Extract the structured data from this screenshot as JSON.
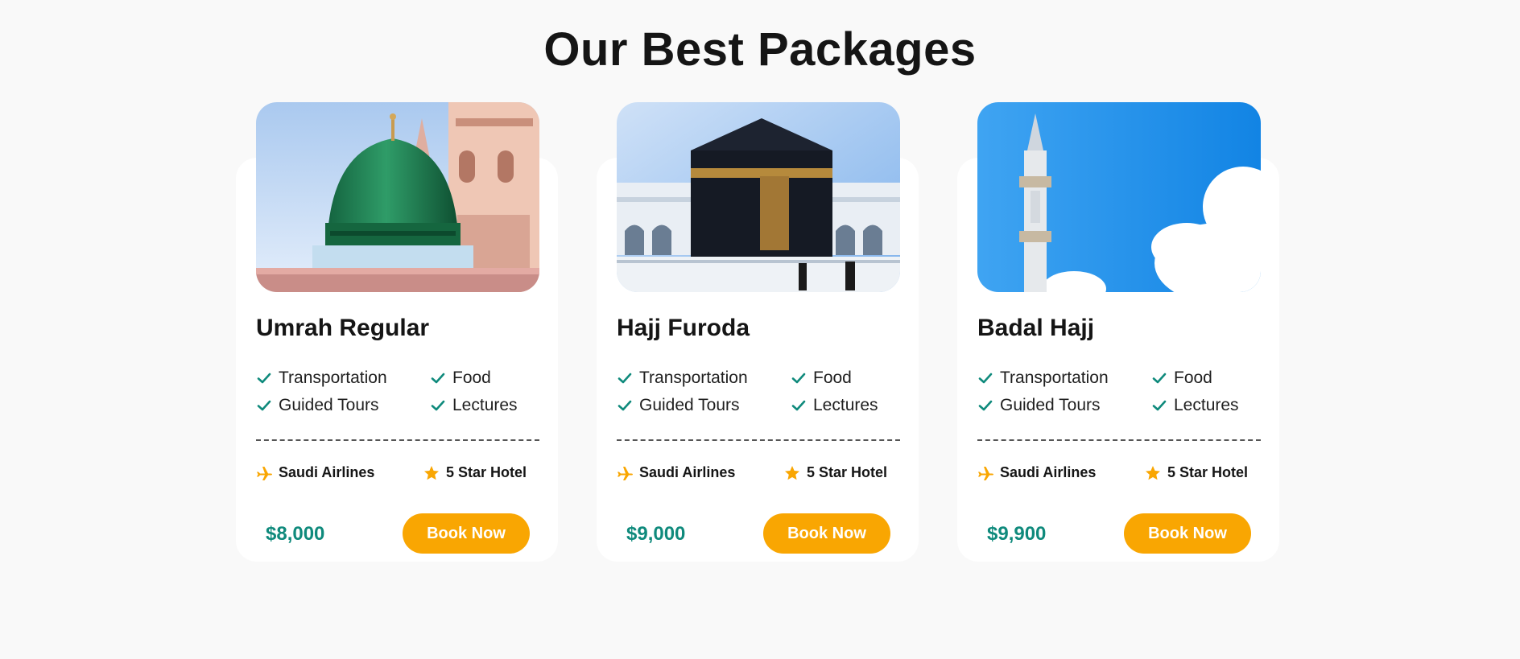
{
  "section": {
    "title": "Our Best Packages"
  },
  "colors": {
    "accent": "#f9a602",
    "price": "#0f8a7c",
    "check": "#0f8a7c",
    "background": "#f9f9f9"
  },
  "packages": [
    {
      "name": "Umrah Regular",
      "image_icon": "green-dome-mosque-image",
      "features": [
        "Transportation",
        "Food",
        "Guided Tours",
        "Lectures"
      ],
      "airline": "Saudi Airlines",
      "hotel": "5 Star Hotel",
      "price": "$8,000",
      "button_label": "Book Now"
    },
    {
      "name": "Hajj Furoda",
      "image_icon": "kaaba-image",
      "features": [
        "Transportation",
        "Food",
        "Guided Tours",
        "Lectures"
      ],
      "airline": "Saudi Airlines",
      "hotel": "5 Star Hotel",
      "price": "$9,000",
      "button_label": "Book Now"
    },
    {
      "name": "Badal Hajj",
      "image_icon": "minaret-sky-image",
      "features": [
        "Transportation",
        "Food",
        "Guided Tours",
        "Lectures"
      ],
      "airline": "Saudi Airlines",
      "hotel": "5 Star Hotel",
      "price": "$9,900",
      "button_label": "Book Now"
    }
  ]
}
